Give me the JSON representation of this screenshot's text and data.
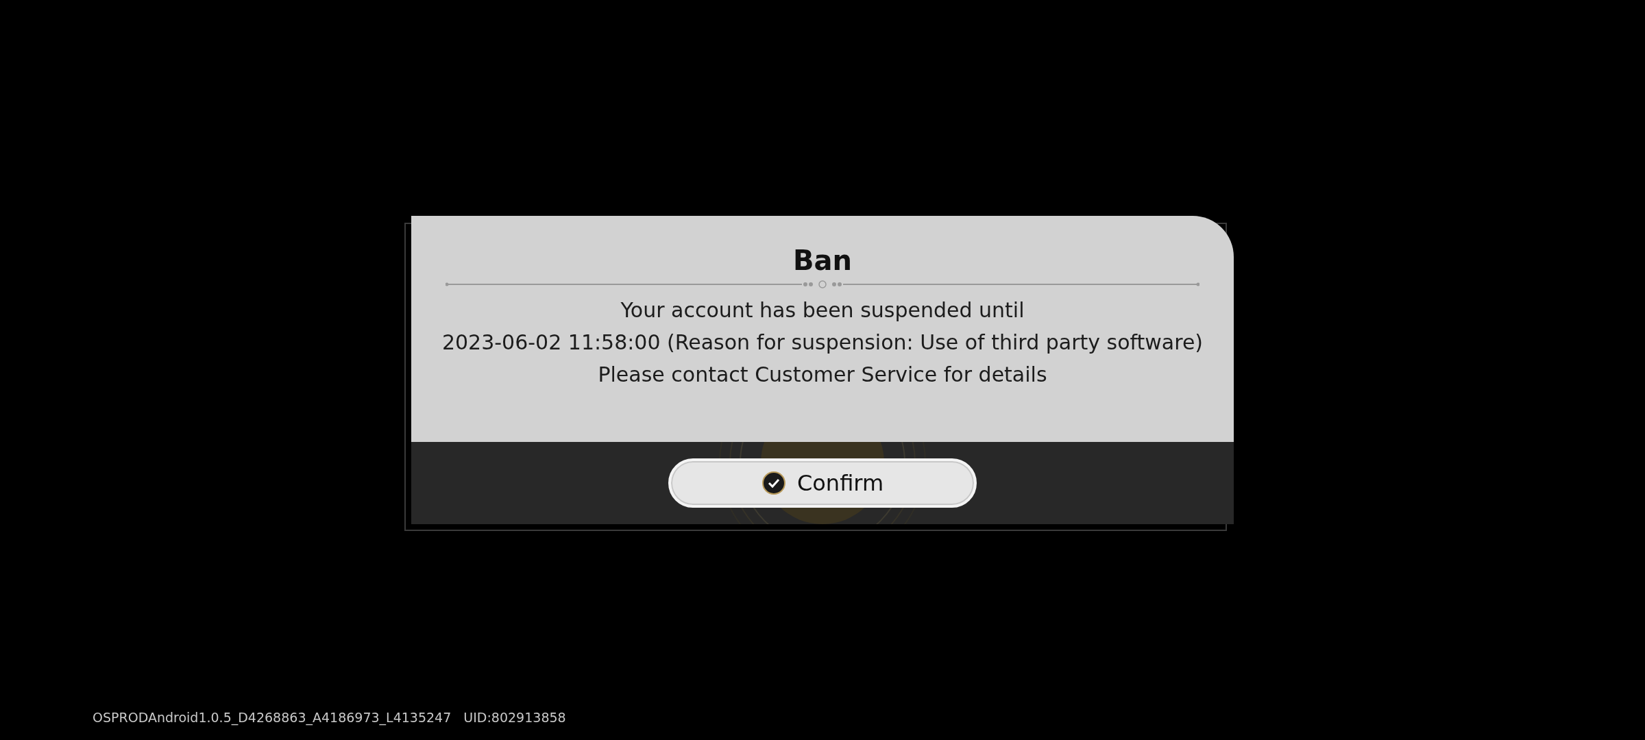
{
  "dialog": {
    "title": "Ban",
    "message": [
      "Your account has been suspended until",
      "2023-06-02 11:58:00 (Reason for suspension: Use of third party software)",
      "Please contact Customer Service for details"
    ],
    "button": "Confirm"
  },
  "footer": {
    "build": "OSPRODAndroid1.0.5_D4268863_A4186973_L4135247",
    "uid": "UID:802913858"
  }
}
